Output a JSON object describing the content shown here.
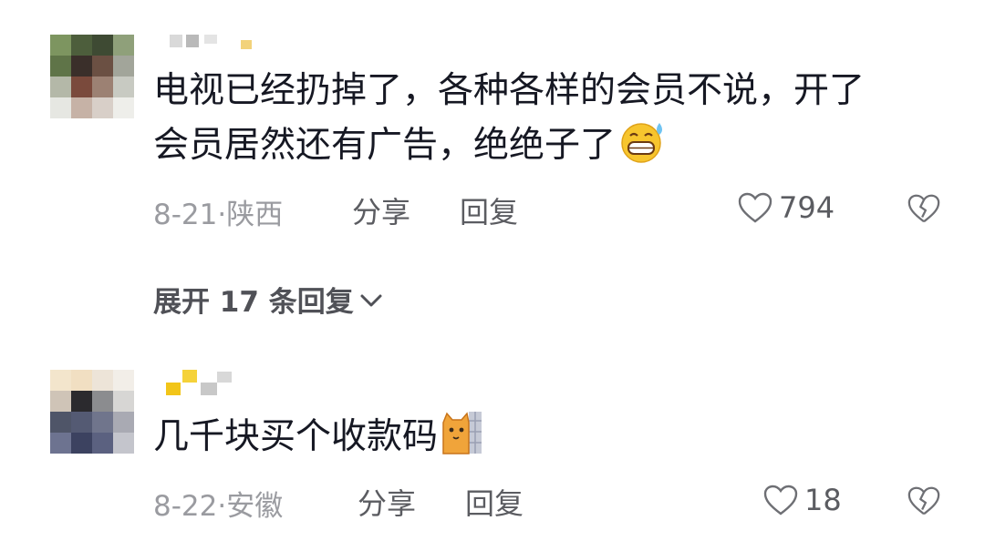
{
  "comments": [
    {
      "text_line1": "电视已经扔掉了，各种各样的会员不说，开了",
      "text_line2": "会员居然还有广告，绝绝子了",
      "date": "8-21",
      "location": "陕西",
      "share_label": "分享",
      "reply_label": "回复",
      "like_count": "794",
      "emoji_icon": "grinning-sweat-emoji"
    },
    {
      "text": "几千块买个收款码",
      "date": "8-22",
      "location": "安徽",
      "share_label": "分享",
      "reply_label": "回复",
      "like_count": "18",
      "emoji_icon": "cat-peeking-wall-emoji"
    }
  ],
  "expand_replies_label": "展开 17 条回复",
  "colors": {
    "text": "#161823",
    "meta": "#9a9ba0",
    "action": "#5b5c61"
  }
}
